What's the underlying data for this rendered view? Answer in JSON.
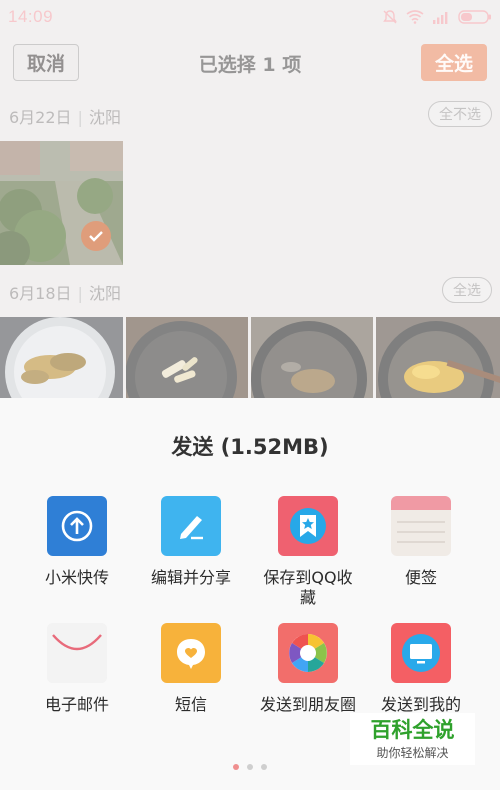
{
  "status_bar": {
    "time": "14:09",
    "icons": [
      "mute-bell-icon",
      "wifi-icon",
      "signal-icon",
      "battery-icon"
    ]
  },
  "header": {
    "cancel_label": "取消",
    "title": "已选择 1 项",
    "select_all_label": "全选"
  },
  "gallery": {
    "sections": [
      {
        "date": "6月22日",
        "location": "沈阳",
        "action_label": "全不选",
        "photos": [
          "park-path-photo"
        ],
        "selected": [
          true
        ]
      },
      {
        "date": "6月18日",
        "location": "沈阳",
        "action_label": "全选",
        "photos": [
          "food-plate-photo",
          "pan-fry-photo",
          "pan-oil-photo",
          "pan-egg-photo"
        ]
      }
    ]
  },
  "share_sheet": {
    "title": "发送 (1.52MB)",
    "items": [
      {
        "label": "小米快传",
        "icon": "mi-drop-icon",
        "color": "#2f7fd6"
      },
      {
        "label": "编辑并分享",
        "icon": "edit-share-icon",
        "color": "#3fb4ef"
      },
      {
        "label": "保存到QQ收藏",
        "icon": "qq-favorites-icon",
        "color": "#ef6170"
      },
      {
        "label": "便签",
        "icon": "notes-icon",
        "color": "#f0ebe6"
      },
      {
        "label": "电子邮件",
        "icon": "email-icon",
        "color": "#eeeeee"
      },
      {
        "label": "短信",
        "icon": "sms-icon",
        "color": "#f7b23b"
      },
      {
        "label": "发送到朋友圈",
        "icon": "moments-icon",
        "color": "#f26e6b"
      },
      {
        "label": "发送到我的",
        "icon": "my-computer-icon",
        "color": "#f45f64"
      }
    ],
    "page_count": 3,
    "current_page": 1
  },
  "watermark": {
    "title": "百科全说",
    "subtitle": "助你轻松解决"
  }
}
